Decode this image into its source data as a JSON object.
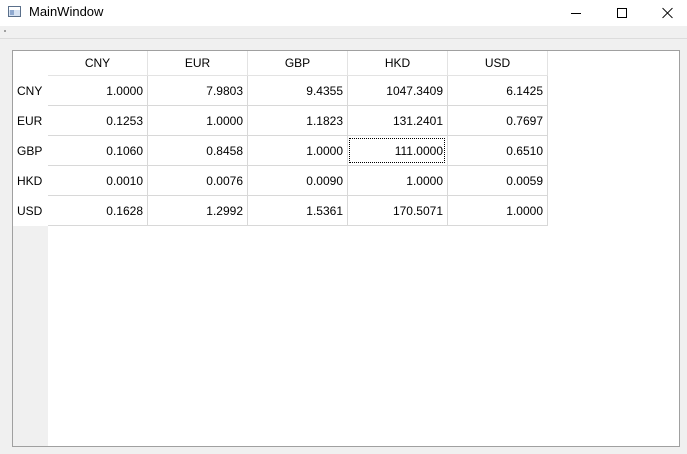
{
  "window": {
    "title": "MainWindow"
  },
  "table": {
    "columns": [
      "CNY",
      "EUR",
      "GBP",
      "HKD",
      "USD"
    ],
    "rows": [
      {
        "header": "CNY",
        "cells": [
          "1.0000",
          "7.9803",
          "9.4355",
          "1047.3409",
          "6.1425"
        ]
      },
      {
        "header": "EUR",
        "cells": [
          "0.1253",
          "1.0000",
          "1.1823",
          "131.2401",
          "0.7697"
        ]
      },
      {
        "header": "GBP",
        "cells": [
          "0.1060",
          "0.8458",
          "1.0000",
          "111.0000",
          "0.6510"
        ]
      },
      {
        "header": "HKD",
        "cells": [
          "0.0010",
          "0.0076",
          "0.0090",
          "1.0000",
          "0.0059"
        ]
      },
      {
        "header": "USD",
        "cells": [
          "0.1628",
          "1.2992",
          "1.5361",
          "170.5071",
          "1.0000"
        ]
      }
    ],
    "focused_cell": {
      "row": 2,
      "col": 3
    }
  }
}
